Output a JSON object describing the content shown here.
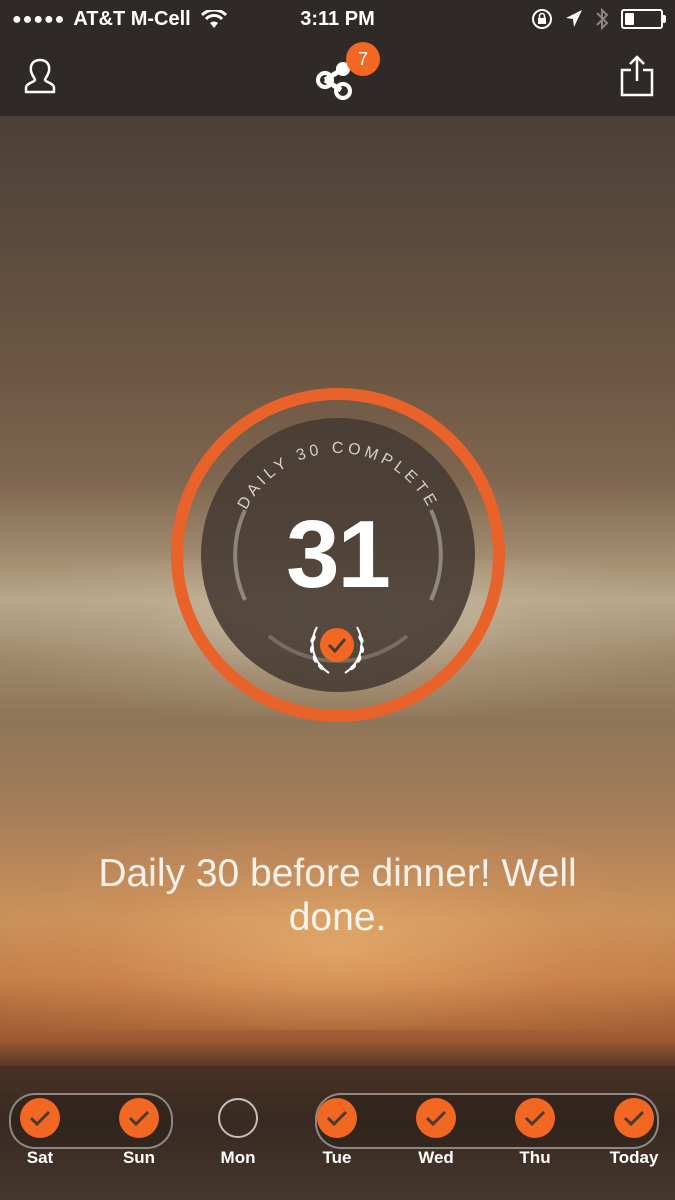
{
  "status_bar": {
    "signal_dots": "●●●●●",
    "carrier": "AT&T M-Cell",
    "time": "3:11 PM"
  },
  "nav": {
    "badge_count": "7",
    "icons": [
      "profile-icon",
      "chain-icon",
      "share-icon"
    ]
  },
  "ring": {
    "arc_label": "DAILY 30 COMPLETE",
    "number": "31"
  },
  "message": "Daily 30 before dinner! Well done.",
  "week": {
    "days": [
      {
        "label": "Sat",
        "done": true
      },
      {
        "label": "Sun",
        "done": true
      },
      {
        "label": "Mon",
        "done": false
      },
      {
        "label": "Tue",
        "done": true
      },
      {
        "label": "Wed",
        "done": true
      },
      {
        "label": "Thu",
        "done": true
      },
      {
        "label": "Today",
        "done": true
      }
    ]
  },
  "colors": {
    "accent": "#f26722",
    "bar": "#2f2a27"
  }
}
